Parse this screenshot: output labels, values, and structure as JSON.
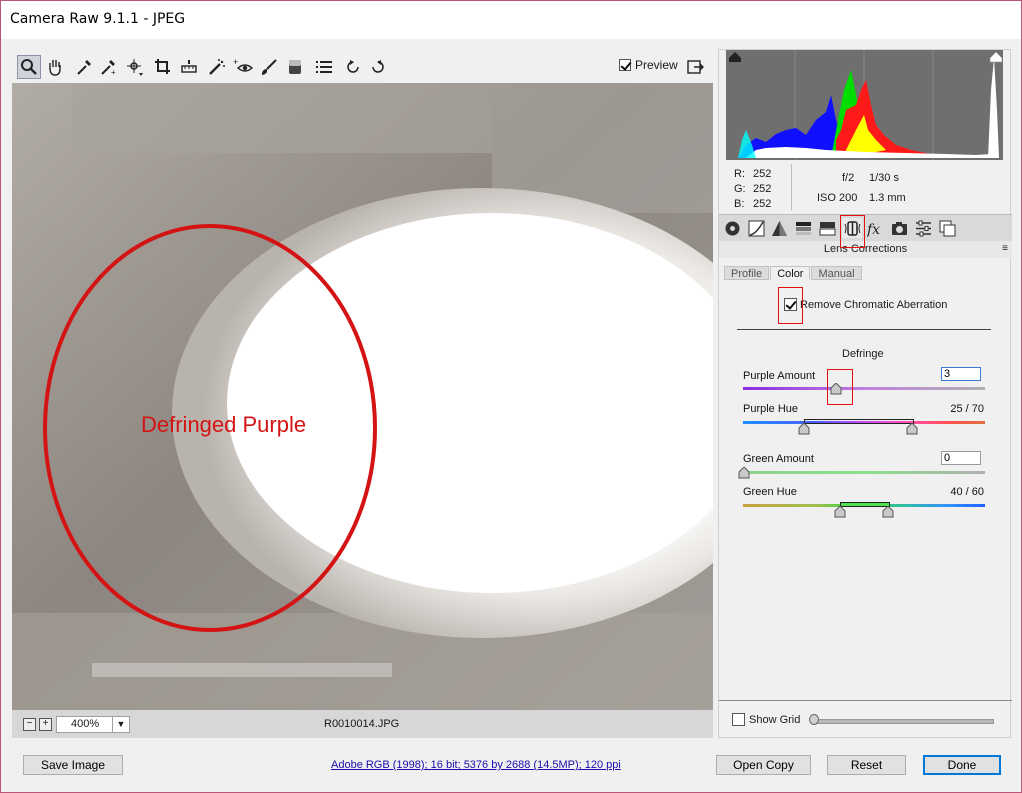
{
  "window": {
    "title": "Camera Raw 9.1.1  -  JPEG"
  },
  "toolbar": {
    "tools": [
      "zoom-tool",
      "hand-tool",
      "white-balance-tool",
      "color-sampler-tool",
      "targeted-adjustment-tool",
      "crop-tool",
      "straighten-tool",
      "spot-removal-tool",
      "red-eye-removal-tool",
      "adjustment-brush-tool",
      "graduated-filter-tool",
      "preferences-tool",
      "rotate-ccw-tool",
      "rotate-cw-tool"
    ],
    "preview_label": "Preview",
    "preview_checked": true
  },
  "image": {
    "annotation_text": "Defringed Purple",
    "filename": "R0010014.JPG",
    "zoom_value": "400%"
  },
  "info": {
    "r_label": "R:",
    "g_label": "G:",
    "b_label": "B:",
    "r_value": "252",
    "g_value": "252",
    "b_value": "252",
    "aperture": "f/2",
    "shutter": "1/30 s",
    "iso": "ISO 200",
    "focal": "1.3 mm"
  },
  "panel": {
    "header": "Lens Corrections",
    "tabs": [
      "Profile",
      "Color",
      "Manual"
    ],
    "active_tab": "Color",
    "remove_ca_label": "Remove Chromatic Aberration",
    "remove_ca_checked": true,
    "defringe_title": "Defringe",
    "purple_amount_label": "Purple Amount",
    "purple_amount_value": "3",
    "purple_hue_label": "Purple Hue",
    "purple_hue_value": "25 / 70",
    "green_amount_label": "Green Amount",
    "green_amount_value": "0",
    "green_hue_label": "Green Hue",
    "green_hue_value": "40 / 60",
    "show_grid_label": "Show Grid",
    "show_grid_checked": false
  },
  "footer": {
    "save_label": "Save Image",
    "workflow_link": "Adobe RGB (1998); 16 bit; 5376 by 2688 (14.5MP); 120 ppi",
    "open_copy_label": "Open Copy",
    "reset_label": "Reset",
    "done_label": "Done"
  },
  "colors": {
    "annotation_red": "#d41414",
    "accent_blue": "#0078d7"
  }
}
